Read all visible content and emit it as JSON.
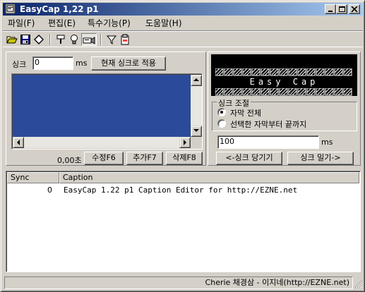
{
  "window": {
    "title": "EasyCap 1,22 p1",
    "minimize_icon": "minimize-icon",
    "maximize_icon": "maximize-icon",
    "close_icon": "close-icon"
  },
  "menu": [
    {
      "label": "파일(F)"
    },
    {
      "label": "편집(E)"
    },
    {
      "label": "특수기능(P)"
    },
    {
      "label": "도움말(H)"
    }
  ],
  "toolbar": {
    "icons": [
      "open-folder-icon",
      "save-icon",
      "diamond-icon",
      "wrench-icon",
      "lightbulb-icon",
      "video-icon",
      "filter-icon",
      "clipboard-icon"
    ]
  },
  "sync_panel": {
    "sync_label": "싱크",
    "sync_value": "0",
    "ms_label": "ms",
    "apply_button": "현재 싱크로 적용",
    "time_display": "0,00초",
    "edit_button": "수정F6",
    "add_button": "추가F7",
    "delete_button": "삭제F8",
    "editor_color": "#2b4b9a"
  },
  "preview": {
    "title": "Easy Cap"
  },
  "sync_adjust": {
    "group_label": "싱크 조절",
    "option_all": "자막 전체",
    "option_selected": "선택한 자막부터 끝까지",
    "selected_option": "자막 전체",
    "offset_value": "100",
    "ms_label": "ms",
    "pull_button": "<-싱크 당기기",
    "push_button": "싱크 밀기->"
  },
  "table": {
    "columns": [
      "Sync",
      "Caption"
    ],
    "rows": [
      {
        "sync": "0",
        "caption": "EasyCap 1.22 p1 Caption Editor for http://EZNE.net"
      }
    ]
  },
  "status": {
    "text": "Cherie 채경삼 - 이지네(http://EZNE.net)"
  }
}
